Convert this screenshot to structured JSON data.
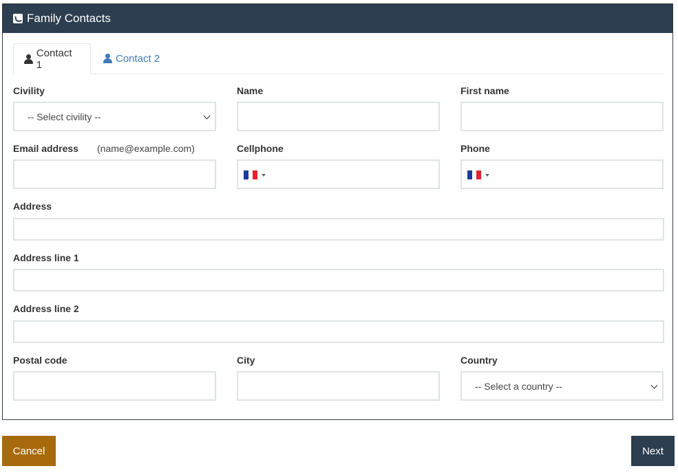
{
  "header": {
    "title": "Family Contacts"
  },
  "tabs": [
    {
      "label": "Contact 1",
      "active": true
    },
    {
      "label": "Contact 2",
      "active": false
    }
  ],
  "form": {
    "civility": {
      "label": "Civility",
      "value": "-- Select civility --"
    },
    "name": {
      "label": "Name",
      "value": ""
    },
    "first_name": {
      "label": "First name",
      "value": ""
    },
    "email": {
      "label": "Email address",
      "hint": "(name@example.com)",
      "value": ""
    },
    "cellphone": {
      "label": "Cellphone",
      "value": ""
    },
    "phone": {
      "label": "Phone",
      "value": ""
    },
    "address": {
      "label": "Address",
      "value": ""
    },
    "address_line1": {
      "label": "Address line 1",
      "value": ""
    },
    "address_line2": {
      "label": "Address line 2",
      "value": ""
    },
    "postal_code": {
      "label": "Postal code",
      "value": ""
    },
    "city": {
      "label": "City",
      "value": ""
    },
    "country": {
      "label": "Country",
      "value": "-- Select a country --"
    }
  },
  "buttons": {
    "cancel": "Cancel",
    "next": "Next"
  },
  "colors": {
    "header_bg": "#2c3e50",
    "tab_link": "#3d7ab8",
    "cancel_bg": "#a86a0c",
    "next_bg": "#2c3e50",
    "flag_blue": "#1a3a9c",
    "flag_white": "#ffffff",
    "flag_red": "#e0262e"
  },
  "icons": {
    "header": "phone-square-icon",
    "tab": "user-icon",
    "flag": "france-flag-icon"
  }
}
